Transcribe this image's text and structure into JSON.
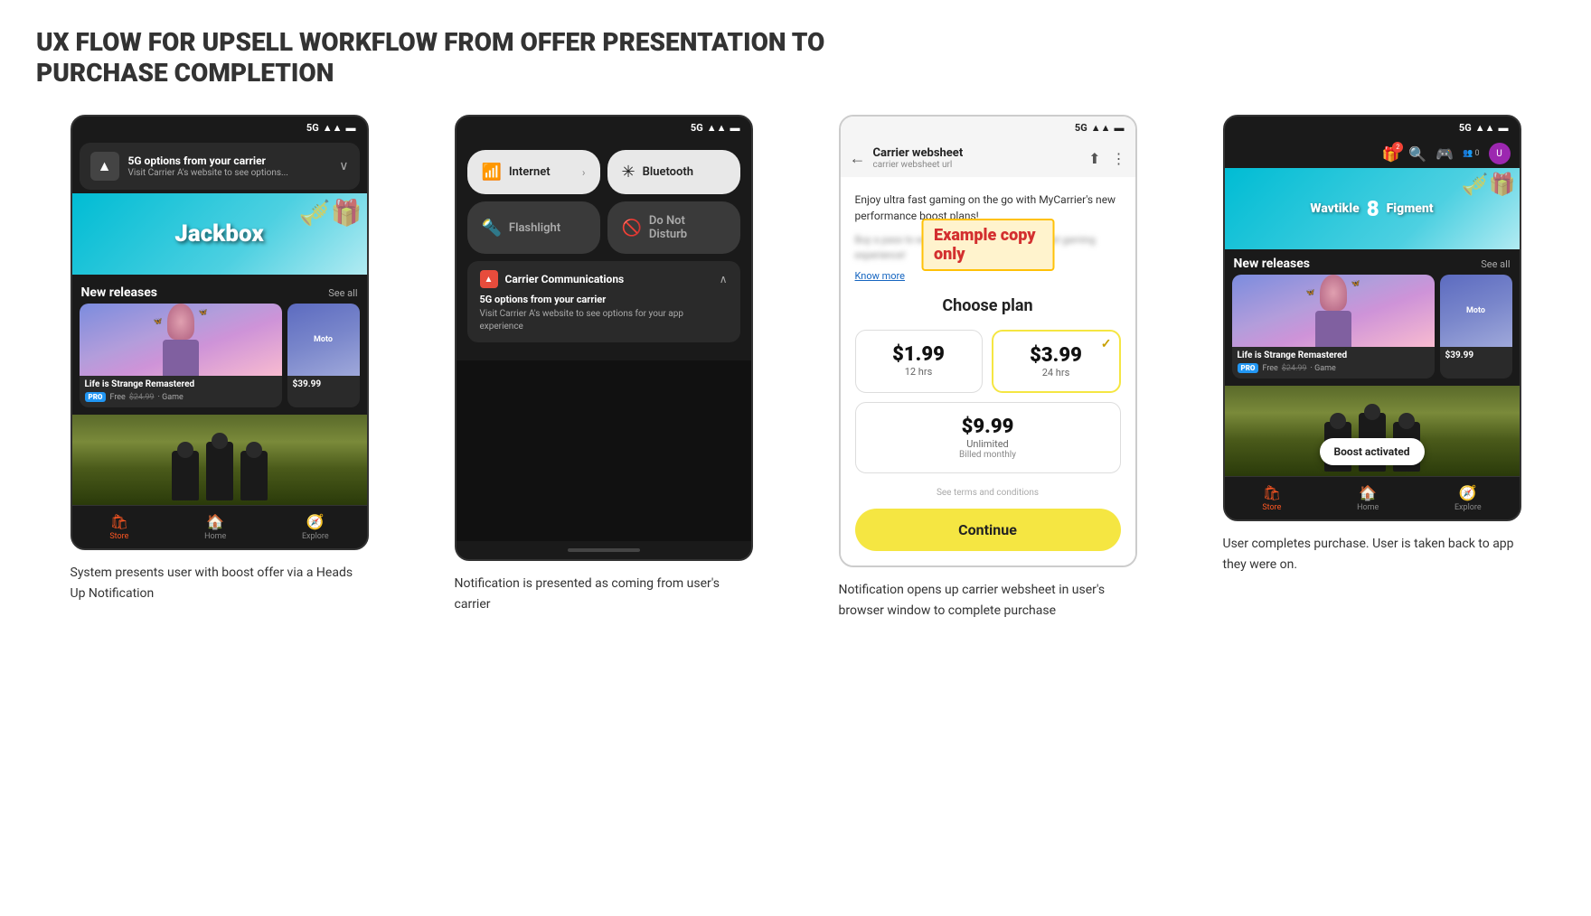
{
  "page": {
    "title": "UX FLOW FOR UPSELL WORKFLOW FROM OFFER PRESENTATION TO PURCHASE COMPLETION"
  },
  "screen1": {
    "status": "5G",
    "notification": {
      "title": "5G options from your carrier",
      "subtitle": "Visit Carrier A's website to see options..."
    },
    "sections": {
      "new_releases": "New releases",
      "see_all": "See all"
    },
    "games": [
      {
        "name": "Life is Strange Remastered",
        "badge": "PRO",
        "price_free": "Free",
        "price_original": "$24.99",
        "type": "Game"
      },
      {
        "name": "Moto",
        "price": "$39.99"
      }
    ],
    "nav": [
      "Store",
      "Home",
      "Explore"
    ],
    "description": "System presents user with boost offer via a Heads Up Notification"
  },
  "screen2": {
    "status": "5G",
    "tiles": [
      {
        "label": "Internet",
        "active": true
      },
      {
        "label": "Bluetooth",
        "active": true
      },
      {
        "label": "Flashlight",
        "active": false
      },
      {
        "label": "Do Not Disturb",
        "active": false
      }
    ],
    "notification": {
      "app": "Carrier Communications",
      "title": "5G options from your carrier",
      "body": "Visit Carrier A's website to see options for your app experience"
    },
    "description": "Notification is presented as coming from user's carrier"
  },
  "screen3": {
    "status": "5G",
    "header": {
      "title": "Carrier websheet",
      "url": "carrier websheet url"
    },
    "body": {
      "desc": "Enjoy ultra fast gaming on the go with MyCarrier's new performance boost plans!",
      "desc2": "Buy a pass to enjoy ultra fast rates for the best gaming experience!",
      "example_label": "Example copy only",
      "know_more": "Know more"
    },
    "choose_plan": "Choose plan",
    "plans": [
      {
        "price": "$1.99",
        "duration": "12 hrs",
        "selected": false
      },
      {
        "price": "$3.99",
        "duration": "24 hrs",
        "selected": true
      },
      {
        "price": "$9.99",
        "duration": "Unlimited",
        "note": "Billed monthly",
        "selected": false
      }
    ],
    "terms": "See terms and conditions",
    "continue_btn": "Continue",
    "description": "Notification opens up carrier websheet in user's browser window to complete purchase"
  },
  "screen4": {
    "status": "5G",
    "sections": {
      "new_releases": "New releases",
      "see_all": "See all"
    },
    "games": [
      {
        "name": "Life is Strange Remastered",
        "badge": "PRO",
        "price_free": "Free",
        "price_original": "$24.99",
        "type": "Game"
      },
      {
        "name": "Moto",
        "price": "$39.99"
      }
    ],
    "boost_toast": "Boost activated",
    "nav": [
      "Store",
      "Home",
      "Explore"
    ],
    "description": "User completes purchase. User is taken back to app they were on."
  },
  "icons": {
    "wifi": "📶",
    "bluetooth": "🔵",
    "flashlight": "🔦",
    "dnd": "🌙",
    "store": "🛍",
    "home": "🏠",
    "explore": "🧭",
    "signal": "▲",
    "battery": "🔋",
    "back": "←",
    "share": "⬆",
    "more": "⋮",
    "search": "🔍",
    "game_controller": "🎮",
    "gift": "🎁",
    "friends": "👥",
    "carrier": "▲"
  }
}
